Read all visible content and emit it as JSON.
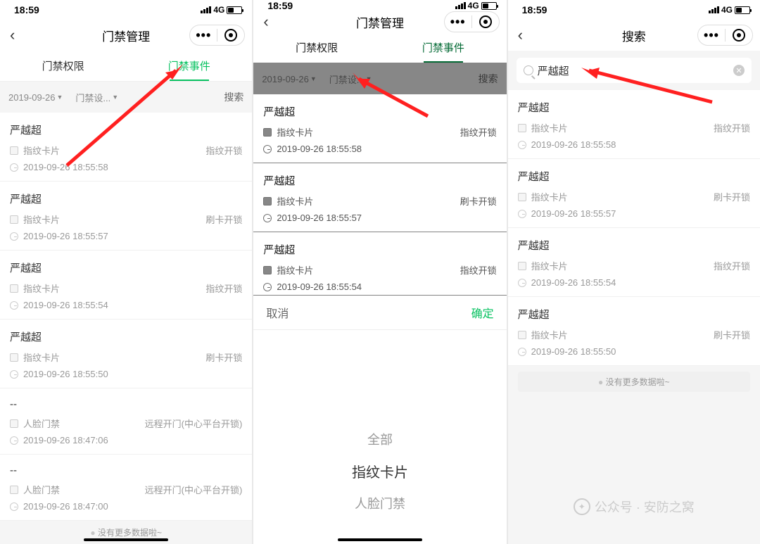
{
  "status": {
    "time": "18:59",
    "network": "4G"
  },
  "nav": {
    "title_manage": "门禁管理",
    "title_search": "搜索"
  },
  "capsule": {
    "menu": "•••"
  },
  "tabs": {
    "perm": "门禁权限",
    "event": "门禁事件"
  },
  "filter": {
    "date": "2019-09-26",
    "device": "门禁设...",
    "search_label": "搜索"
  },
  "picker": {
    "cancel": "取消",
    "confirm": "确定",
    "opt_all": "全部",
    "opt_card": "指纹卡片",
    "opt_face": "人脸门禁"
  },
  "search": {
    "value": "严越超"
  },
  "no_more": "没有更多数据啦~",
  "watermark": "公众号 · 安防之窝",
  "screen1_events": [
    {
      "name": "严越超",
      "type": "指纹卡片",
      "method": "指纹开锁",
      "time": "2019-09-26 18:55:58"
    },
    {
      "name": "严越超",
      "type": "指纹卡片",
      "method": "刷卡开锁",
      "time": "2019-09-26 18:55:57"
    },
    {
      "name": "严越超",
      "type": "指纹卡片",
      "method": "指纹开锁",
      "time": "2019-09-26 18:55:54"
    },
    {
      "name": "严越超",
      "type": "指纹卡片",
      "method": "刷卡开锁",
      "time": "2019-09-26 18:55:50"
    },
    {
      "name": "--",
      "type": "人脸门禁",
      "method": "远程开门(中心平台开锁)",
      "time": "2019-09-26 18:47:06"
    },
    {
      "name": "--",
      "type": "人脸门禁",
      "method": "远程开门(中心平台开锁)",
      "time": "2019-09-26 18:47:00"
    }
  ],
  "screen2_events": [
    {
      "name": "严越超",
      "type": "指纹卡片",
      "method": "指纹开锁",
      "time": "2019-09-26 18:55:58"
    },
    {
      "name": "严越超",
      "type": "指纹卡片",
      "method": "刷卡开锁",
      "time": "2019-09-26 18:55:57"
    },
    {
      "name": "严越超",
      "type": "指纹卡片",
      "method": "指纹开锁",
      "time": "2019-09-26 18:55:54"
    }
  ],
  "screen3_events": [
    {
      "name": "严越超",
      "type": "指纹卡片",
      "method": "指纹开锁",
      "time": "2019-09-26 18:55:58"
    },
    {
      "name": "严越超",
      "type": "指纹卡片",
      "method": "刷卡开锁",
      "time": "2019-09-26 18:55:57"
    },
    {
      "name": "严越超",
      "type": "指纹卡片",
      "method": "指纹开锁",
      "time": "2019-09-26 18:55:54"
    },
    {
      "name": "严越超",
      "type": "指纹卡片",
      "method": "刷卡开锁",
      "time": "2019-09-26 18:55:50"
    }
  ]
}
